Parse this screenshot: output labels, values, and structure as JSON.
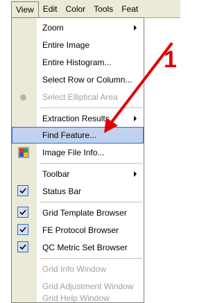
{
  "menubar": {
    "items": [
      "View",
      "Edit",
      "Color",
      "Tools",
      "Feat"
    ]
  },
  "menu": {
    "items": [
      {
        "label": "Zoom"
      },
      {
        "label": "Entire Image"
      },
      {
        "label": "Entire Histogram..."
      },
      {
        "label": "Select Row or Column..."
      },
      {
        "label": "Select Elliptical Area"
      },
      {
        "label": "Extraction Results"
      },
      {
        "label": "Find Feature..."
      },
      {
        "label": "Image File Info..."
      },
      {
        "label": "Toolbar"
      },
      {
        "label": "Status Bar"
      },
      {
        "label": "Grid Template Browser"
      },
      {
        "label": "FE Protocol Browser"
      },
      {
        "label": "QC Metric Set Browser"
      },
      {
        "label": "Grid Info Window"
      },
      {
        "label": "Grid Adjustment Window"
      },
      {
        "label": "Grid Help Window"
      }
    ]
  },
  "annotation": {
    "label": "1",
    "color": "#e00000"
  },
  "colors": {
    "highlight": "#c1d2ee",
    "highlight_border": "#316ac5",
    "menubar_bg": "#ece9d8"
  }
}
